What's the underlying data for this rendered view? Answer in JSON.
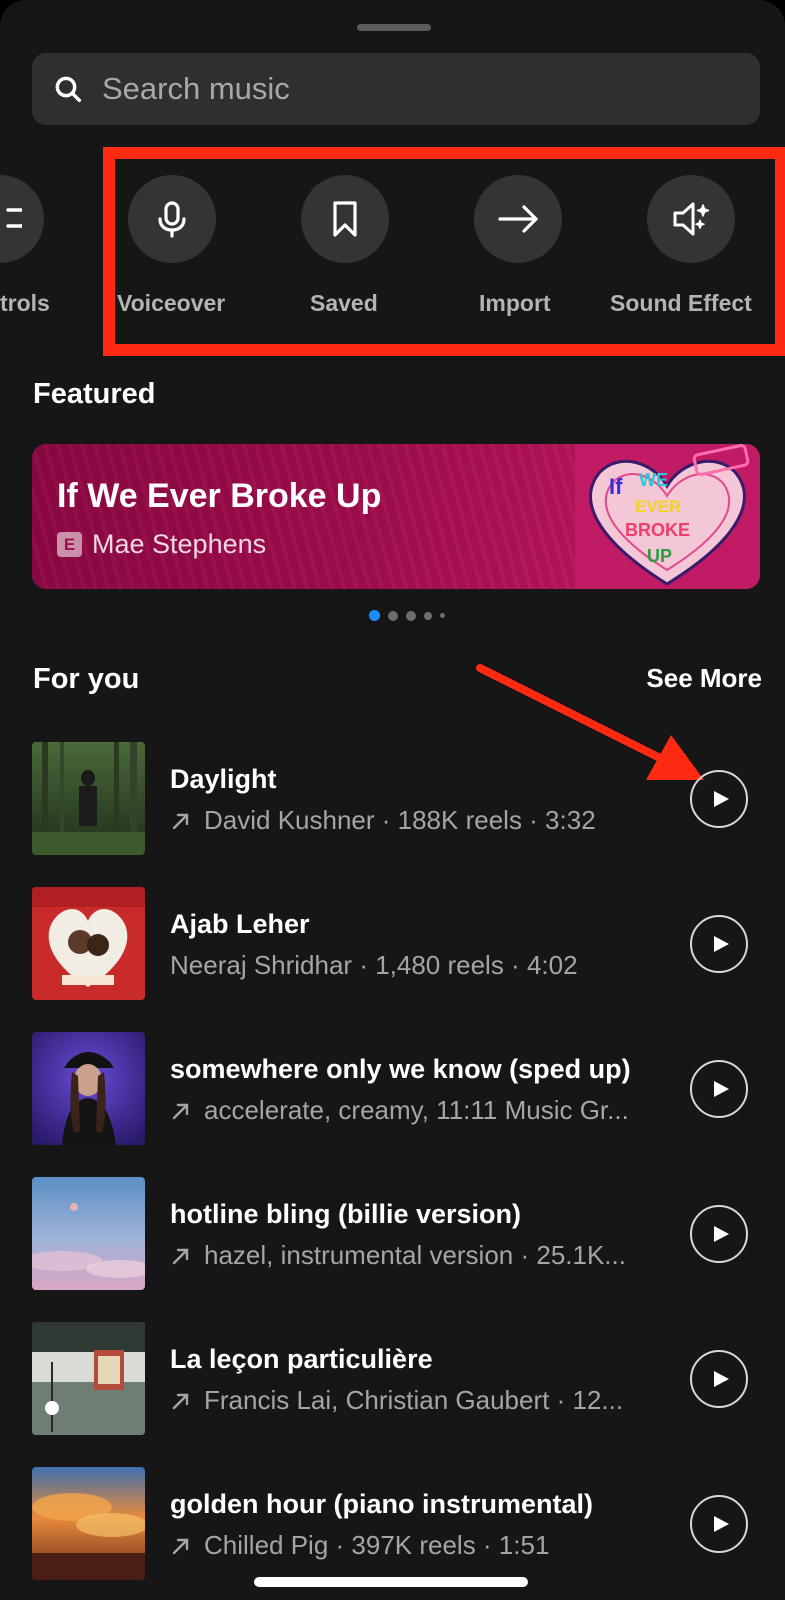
{
  "search": {
    "placeholder": "Search music"
  },
  "tools": [
    {
      "label": "Controls",
      "visible_label": "trols",
      "icon": "sliders-icon"
    },
    {
      "label": "Voiceover",
      "icon": "microphone-icon"
    },
    {
      "label": "Saved",
      "icon": "bookmark-icon"
    },
    {
      "label": "Import",
      "icon": "arrow-right-icon"
    },
    {
      "label": "Sound Effects",
      "visible_label": "Sound Effect",
      "icon": "sound-sparkle-icon"
    }
  ],
  "featured": {
    "heading": "Featured",
    "title": "If We Ever Broke Up",
    "explicit_badge": "E",
    "artist": "Mae Stephens",
    "art_text": [
      "If",
      "WE",
      "EVER",
      "BROKE",
      "UP"
    ],
    "pager_count": 5,
    "pager_active": 0
  },
  "for_you": {
    "heading": "For you",
    "see_more": "See More",
    "tracks": [
      {
        "title": "Daylight",
        "subtitle": "David Kushner · 188K reels · 3:32",
        "trending": true
      },
      {
        "title": "Ajab Leher",
        "subtitle": "Neeraj Shridhar · 1,480 reels · 4:02",
        "trending": false
      },
      {
        "title": "somewhere only we know (sped up)",
        "subtitle": "accelerate, creamy, 11:11 Music Gr...",
        "trending": true
      },
      {
        "title": "hotline bling (billie version)",
        "subtitle": "hazel, instrumental version · 25.1K...",
        "trending": true
      },
      {
        "title": "La leçon particulière",
        "subtitle": "Francis Lai, Christian Gaubert · 12...",
        "trending": true
      },
      {
        "title": "golden hour (piano instrumental)",
        "subtitle": "Chilled Pig · 397K reels · 1:51",
        "trending": true
      }
    ]
  },
  "colors": {
    "background": "#161616",
    "highlight": "#ff2a12",
    "accent_dot": "#1a8cff"
  }
}
